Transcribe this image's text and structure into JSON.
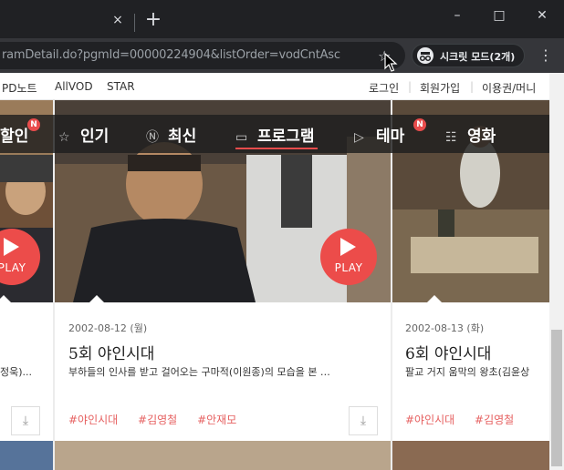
{
  "browser": {
    "tab_close": "×",
    "new_tab": "+",
    "url": "ramDetail.do?pgmId=00000224904&listOrder=vodCntAsc",
    "incognito_label": "시크릿 모드(2개)"
  },
  "sitenav": {
    "left": [
      "PD노트",
      "AllVOD",
      "STAR"
    ],
    "right": [
      "로그인",
      "회원가입",
      "이용권/머니"
    ]
  },
  "categories": [
    {
      "label": "할인",
      "badge": "N"
    },
    {
      "label": "인기",
      "icon": "star-icon"
    },
    {
      "label": "최신",
      "icon": "new-icon"
    },
    {
      "label": "프로그램",
      "icon": "tv-icon",
      "active": true
    },
    {
      "label": "테마",
      "icon": "play-box-icon",
      "badge": "N"
    },
    {
      "label": "영화",
      "icon": "film-icon"
    }
  ],
  "cards": [
    {
      "desc_tail": "정욱)...",
      "play": "PLAY"
    },
    {
      "date": "2002-08-12 (월)",
      "title": "5회 야인시대",
      "desc": "부하들의 인사를 받고 걸어오는 구마적(이원종)의 모습을 본 …",
      "tags": [
        "#야인시대",
        "#김영철",
        "#안재모"
      ],
      "play": "PLAY"
    },
    {
      "date": "2002-08-13 (화)",
      "title": "6회 야인시대",
      "desc": "팔교 거지 움막의 왕초(김윤상",
      "tags": [
        "#야인시대",
        "#김영철"
      ]
    }
  ]
}
